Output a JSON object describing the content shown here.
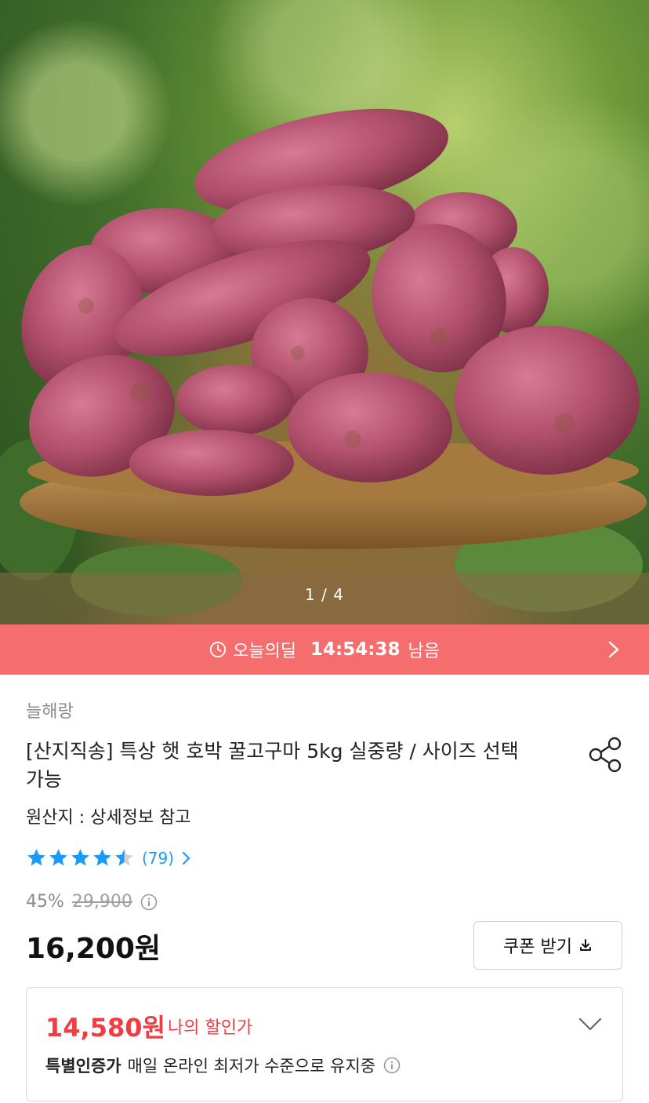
{
  "gallery": {
    "page": "1 / 4"
  },
  "deal_banner": {
    "label": "오늘의딜",
    "time": "14:54:38",
    "suffix": "남음",
    "color": "#f66d6d"
  },
  "product": {
    "brand": "늘해랑",
    "title": "[산지직송] 특상 햇 호박 꿀고구마 5kg 실중량 / 사이즈 선택가능",
    "origin": "원산지 : 상세정보 참고",
    "rating": {
      "stars": 4.5,
      "count": "(79)"
    },
    "discount_percent": "45%",
    "original_price": "29,900",
    "price": "16,200원",
    "coupon_button": "쿠폰 받기"
  },
  "my_discount": {
    "price": "14,580원",
    "label": "나의 할인가",
    "special_title": "특별인증가",
    "special_desc": "매일 온라인 최저가 수준으로 유지중"
  },
  "colors": {
    "accent_red": "#f23c44",
    "star_blue": "#1a9bfb"
  },
  "icons": [
    "clock-icon",
    "chevron-right-icon",
    "share-icon",
    "star-icon",
    "info-icon",
    "download-icon",
    "chevron-down-icon"
  ]
}
